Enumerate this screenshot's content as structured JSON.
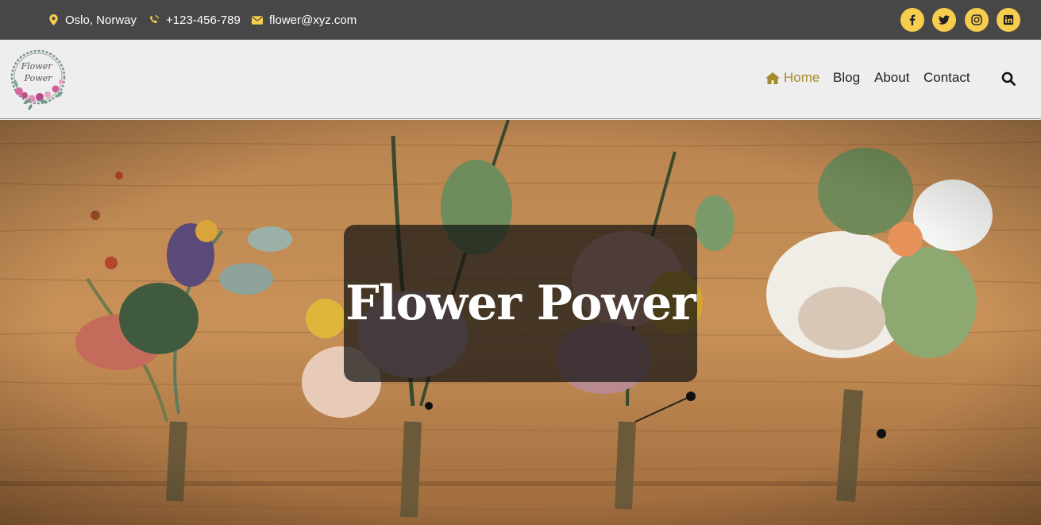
{
  "topbar": {
    "location": "Oslo, Norway",
    "phone": "+123-456-789",
    "email": "flower@xyz.com",
    "social": [
      "facebook-icon",
      "twitter-icon",
      "instagram-icon",
      "linkedin-icon"
    ]
  },
  "nav": {
    "home": "Home",
    "blog": "Blog",
    "about": "About",
    "contact": "Contact"
  },
  "logo": {
    "line1": "Flower",
    "line2": "Power"
  },
  "hero": {
    "title": "Flower Power"
  },
  "colors": {
    "topbar": "#474747",
    "accent": "#f7cd4e",
    "active_link": "#a48a2a",
    "navbar": "#eeeeee"
  }
}
